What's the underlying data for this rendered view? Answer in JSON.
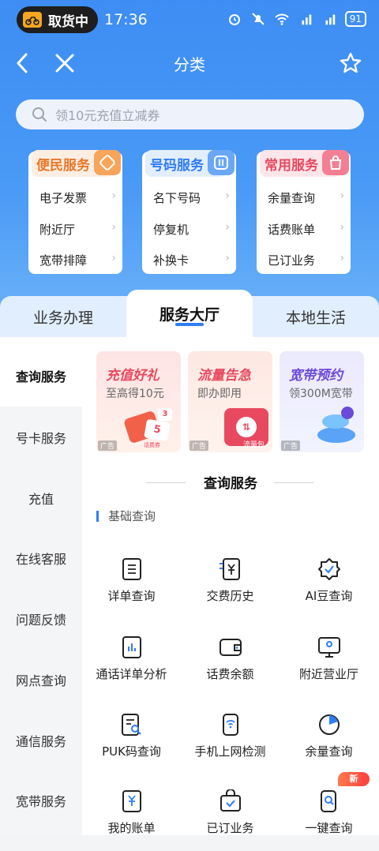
{
  "status_bar": {
    "pickup_label": "取货中",
    "time": "17:36",
    "battery": "91"
  },
  "nav": {
    "title": "分类"
  },
  "search": {
    "placeholder": "领10元充值立减券"
  },
  "service_cards": [
    {
      "title": "便民服务",
      "color": "#e8782a",
      "items": [
        "电子发票",
        "附近厅",
        "宽带排障"
      ]
    },
    {
      "title": "号码服务",
      "color": "#2f7cf5",
      "items": [
        "名下号码",
        "停复机",
        "补换卡"
      ]
    },
    {
      "title": "常用服务",
      "color": "#e8495f",
      "items": [
        "余量查询",
        "话费账单",
        "已订业务"
      ]
    }
  ],
  "tabs": [
    "业务办理",
    "服务大厅",
    "本地生活"
  ],
  "active_tab": "服务大厅",
  "sidebar": {
    "items": [
      "查询服务",
      "号卡服务",
      "充值",
      "在线客服",
      "问题反馈",
      "网点查询",
      "通信服务",
      "宽带服务"
    ],
    "active": "查询服务"
  },
  "promos": [
    {
      "title": "充值好礼",
      "subtitle": "至高得10元",
      "ad": "广告",
      "title_color": "#e8495f",
      "graphic_label": "话费券",
      "graphic_number": "5",
      "graphic_number_small": "3"
    },
    {
      "title": "流量告急",
      "subtitle": "即办即用",
      "ad": "广告",
      "title_color": "#e8495f",
      "graphic_label": "流量包"
    },
    {
      "title": "宽带预约",
      "subtitle": "领300M宽带",
      "ad": "广告",
      "title_color": "#6a4bd9"
    }
  ],
  "section": {
    "title": "查询服务",
    "subtitle": "基础查询"
  },
  "grid": [
    {
      "label": "详单查询",
      "icon": "list-doc-icon"
    },
    {
      "label": "交费历史",
      "icon": "yen-receipt-icon"
    },
    {
      "label": "AI豆查询",
      "icon": "badge-check-icon"
    },
    {
      "label": "通话详单分析",
      "icon": "bar-chart-doc-icon"
    },
    {
      "label": "话费余额",
      "icon": "wallet-icon"
    },
    {
      "label": "附近营业厅",
      "icon": "location-monitor-icon"
    },
    {
      "label": "PUK码查询",
      "icon": "doc-search-icon"
    },
    {
      "label": "手机上网检测",
      "icon": "phone-wifi-icon"
    },
    {
      "label": "余量查询",
      "icon": "pie-chart-icon"
    },
    {
      "label": "我的账单",
      "icon": "yen-bill-icon"
    },
    {
      "label": "已订业务",
      "icon": "bag-check-icon"
    },
    {
      "label": "一键查询",
      "icon": "phone-search-icon"
    }
  ],
  "new_badge": "新",
  "colors": {
    "primary": "#2f7cf5",
    "header_gradient_top": "#3d8df4"
  }
}
